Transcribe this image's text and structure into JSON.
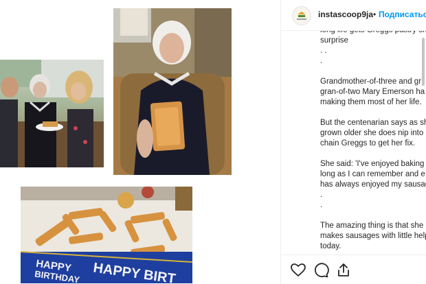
{
  "media": {
    "images": [
      {
        "description": "grandmother-with-family",
        "alt": ""
      },
      {
        "description": "grandmother-with-pastry",
        "alt": ""
      },
      {
        "description": "sausage-rolls-100",
        "alt": ""
      }
    ],
    "banner_text": "HAPPY BIRTHDAY HAPPY BIRT"
  },
  "post": {
    "username": "instascoop9ja",
    "separator": "•",
    "follow_label": "Подписаться",
    "caption": [
      [
        "long life gets Greggs pastry sh",
        "surprise",
        ". .",
        "."
      ],
      [
        "Grandmother-of-three and gr",
        "gran-of-two Mary Emerson ha",
        "making them most of her life."
      ],
      [
        "But the centenarian says as sh",
        "grown older she does nip into",
        "chain Greggs to get her fix."
      ],
      [
        "She said: 'I've enjoyed baking",
        "long as I can remember and e",
        "has always enjoyed my sausag",
        ".",
        "."
      ],
      [
        "The amazing thing is that she",
        "makes sausages with little help",
        "today."
      ]
    ]
  },
  "actions": {
    "like_icon": "heart-icon",
    "comment_icon": "comment-icon",
    "share_icon": "share-icon"
  },
  "colors": {
    "link": "#0095f6",
    "text": "#262626",
    "border": "#efefef"
  }
}
